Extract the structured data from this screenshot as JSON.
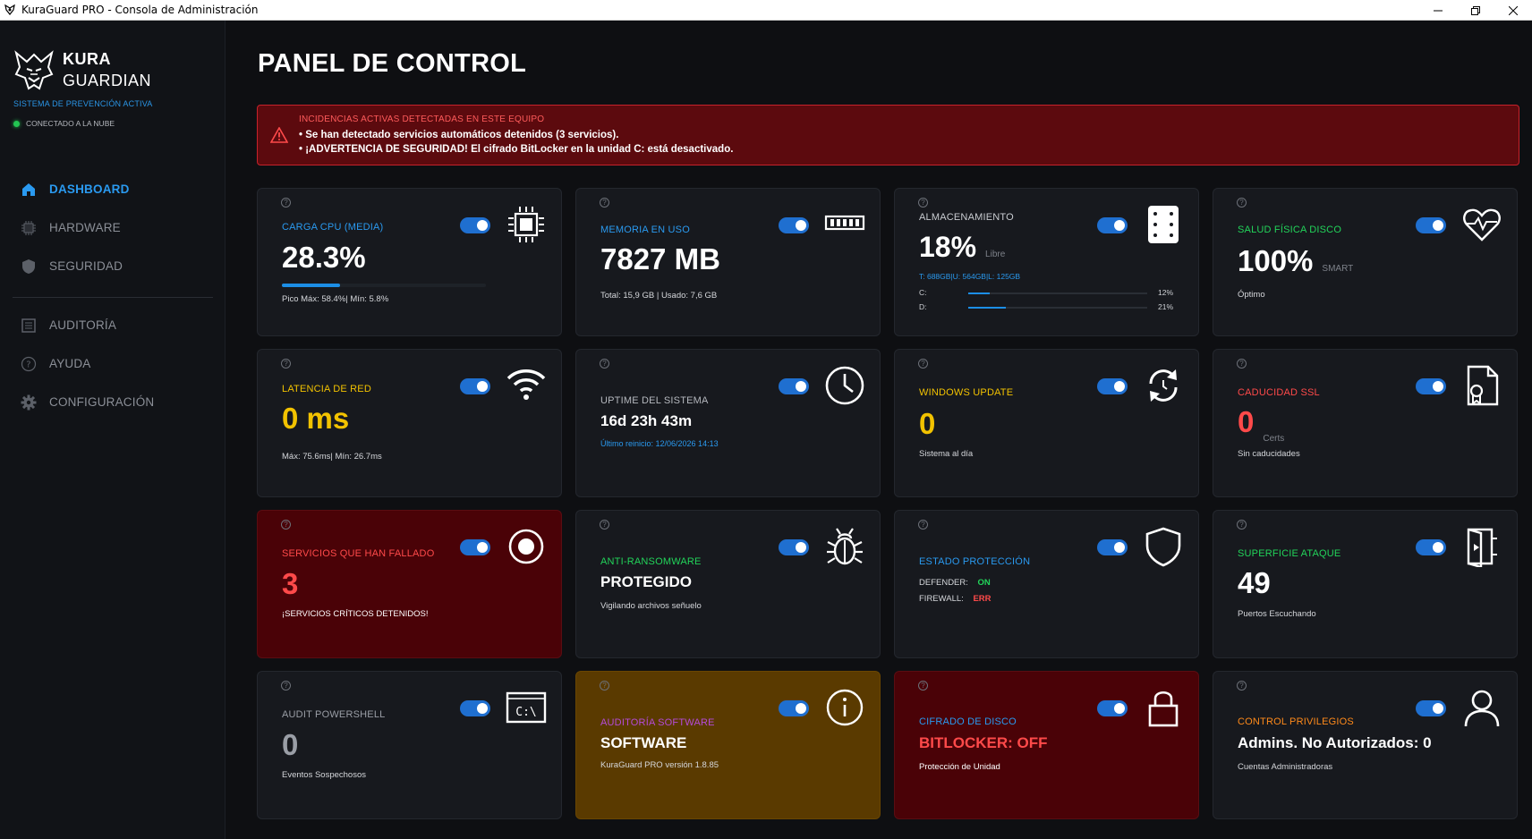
{
  "window": {
    "title": "KuraGuard PRO - Consola de Administración",
    "controls": [
      "minimize",
      "restore",
      "close"
    ]
  },
  "sidebar": {
    "brand_line1": "KURA",
    "brand_line2": "GUARDIAN",
    "system_status": "SISTEMA DE PREVENCIÓN ACTIVA",
    "cloud_status": "CONECTADO A LA NUBE",
    "nav": [
      {
        "label": "DASHBOARD",
        "icon": "home-icon",
        "active": true
      },
      {
        "label": "HARDWARE",
        "icon": "chip-icon",
        "active": false
      },
      {
        "label": "SEGURIDAD",
        "icon": "shield-icon",
        "active": false
      },
      {
        "label": "AUDITORÍA",
        "icon": "list-icon",
        "active": false
      },
      {
        "label": "AYUDA",
        "icon": "help-icon",
        "active": false
      },
      {
        "label": "CONFIGURACIÓN",
        "icon": "gear-icon",
        "active": false
      }
    ]
  },
  "main": {
    "title": "PANEL DE CONTROL",
    "alert": {
      "title": "INCIDENCIAS ACTIVAS DETECTADAS EN ESTE EQUIPO",
      "lines": [
        "• Se han detectado servicios automáticos detenidos (3 servicios).",
        "• ¡ADVERTENCIA DE SEGURIDAD! El cifrado BitLocker en la unidad C: está desactivado."
      ]
    },
    "cards": {
      "cpu": {
        "label": "CARGA CPU (MEDIA)",
        "value": "28.3%",
        "progress": 0.283,
        "sub": "Pico Máx: 58.4%| Mín: 5.8%",
        "help": "?"
      },
      "memory": {
        "label": "MEMORIA EN USO",
        "value": "7827 MB",
        "sub": "Total: 15,9 GB | Usado: 7,6 GB",
        "help": "?"
      },
      "storage": {
        "label": "ALMACENAMIENTO",
        "value": "18%",
        "unit": "Libre",
        "detail": "T: 688GB|U: 564GB|L: 125GB",
        "disks": [
          {
            "name": "C:",
            "pct_label": "12%",
            "used": 0.12
          },
          {
            "name": "D:",
            "pct_label": "21%",
            "used": 0.21
          }
        ],
        "help": "?"
      },
      "disk_health": {
        "label": "SALUD FÍSICA DISCO",
        "value": "100%",
        "unit": "SMART",
        "sub": "Óptimo",
        "help": "?"
      },
      "latency": {
        "label": "LATENCIA DE RED",
        "value": "0 ms",
        "sub": "Máx: 75.6ms| Mín: 26.7ms",
        "help": "?"
      },
      "uptime": {
        "label": "UPTIME DEL SISTEMA",
        "value": "16d 23h 43m",
        "sub": "Último reinicio: 12/06/2026 14:13",
        "help": "?"
      },
      "windows_update": {
        "label": "WINDOWS UPDATE",
        "value": "0",
        "sub": "Sistema al día",
        "help": "?"
      },
      "ssl": {
        "label": "CADUCIDAD SSL",
        "value": "0",
        "unit": "Certs",
        "sub": "Sin caducidades",
        "help": "?"
      },
      "failed_services": {
        "label": "SERVICIOS QUE HAN FALLADO",
        "value": "3",
        "sub": "¡SERVICIOS CRÍTICOS DETENIDOS!",
        "help": "?"
      },
      "ransomware": {
        "label": "ANTI-RANSOMWARE",
        "value": "PROTEGIDO",
        "sub": "Vigilando archivos señuelo",
        "help": "?"
      },
      "protection": {
        "label": "ESTADO PROTECCIÓN",
        "defender_label": "DEFENDER:",
        "defender_value": "ON",
        "firewall_label": "FIREWALL:",
        "firewall_value": "ERR",
        "help": "?"
      },
      "attack_surface": {
        "label": "SUPERFICIE ATAQUE",
        "value": "49",
        "sub": "Puertos Escuchando",
        "help": "?"
      },
      "powershell": {
        "label": "AUDIT POWERSHELL",
        "value": "0",
        "sub": "Eventos Sospechosos",
        "icon_text": "C:\\",
        "help": "?"
      },
      "software": {
        "label": "AUDITORÍA SOFTWARE",
        "value": "SOFTWARE",
        "sub": "KuraGuard PRO versión 1.8.85",
        "help": "?"
      },
      "encryption": {
        "label": "CIFRADO DE DISCO",
        "value": "BITLOCKER: OFF",
        "sub": "Protección de Unidad",
        "help": "?"
      },
      "privileges": {
        "label": "CONTROL PRIVILEGIOS",
        "value": "Admins. No Autorizados: 0",
        "sub": "Cuentas Administradoras",
        "help": "?"
      }
    }
  },
  "colors": {
    "accent": "#2a9af0",
    "alert_bg": "#5c0a0e",
    "alert_border": "#c7222b",
    "card_bg": "#17191e",
    "critical_card": "#4a0207",
    "warning_card": "#5a3a00"
  }
}
